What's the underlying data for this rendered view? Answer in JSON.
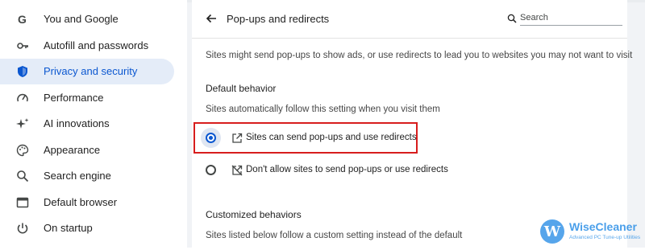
{
  "sidebar": {
    "items": [
      {
        "label": "You and Google",
        "icon": "google-g-icon"
      },
      {
        "label": "Autofill and passwords",
        "icon": "key-icon"
      },
      {
        "label": "Privacy and security",
        "icon": "shield-icon",
        "active": true
      },
      {
        "label": "Performance",
        "icon": "speedometer-icon"
      },
      {
        "label": "AI innovations",
        "icon": "sparkle-icon"
      },
      {
        "label": "Appearance",
        "icon": "palette-icon"
      },
      {
        "label": "Search engine",
        "icon": "search-icon"
      },
      {
        "label": "Default browser",
        "icon": "browser-window-icon"
      },
      {
        "label": "On startup",
        "icon": "power-icon"
      }
    ]
  },
  "header": {
    "title": "Pop-ups and redirects",
    "search_placeholder": "Search"
  },
  "main": {
    "description": "Sites might send pop-ups to show ads, or use redirects to lead you to websites you may not want to visit",
    "default_behavior": {
      "heading": "Default behavior",
      "subtext": "Sites automatically follow this setting when you visit them",
      "options": [
        {
          "label": "Sites can send pop-ups and use redirects",
          "icon": "open-in-new-icon",
          "selected": true
        },
        {
          "label": "Don't allow sites to send pop-ups or use redirects",
          "icon": "blocked-popup-icon",
          "selected": false
        }
      ]
    },
    "customized_behaviors": {
      "heading": "Customized behaviors",
      "subtext": "Sites listed below follow a custom setting instead of the default"
    }
  },
  "watermark": {
    "logo_letter": "W",
    "name": "WiseCleaner",
    "tagline": "Advanced PC Tune-up Utilities"
  },
  "colors": {
    "accent": "#0b57d0",
    "active_bg": "#e4ecf8",
    "highlight_border": "#d71d1d",
    "watermark": "#1e88e5"
  }
}
